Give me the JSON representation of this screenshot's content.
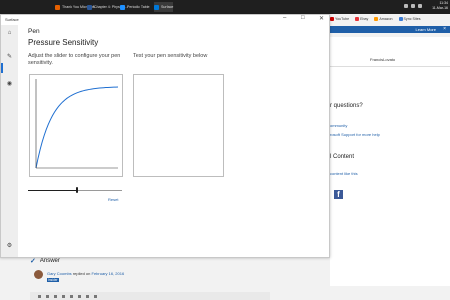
{
  "taskbar": {
    "apps": [
      {
        "label": "Thank You Microsoft...",
        "color": "#e66000",
        "active": false
      },
      {
        "label": "Chapter 4: Physical...",
        "color": "#2b5797",
        "active": false
      },
      {
        "label": "Periodic Table",
        "color": "#1e90ff",
        "active": false
      },
      {
        "label": "Surface",
        "color": "#0078d7",
        "active": true
      }
    ],
    "time": "11:34",
    "date": "11-Mar-16"
  },
  "browser": {
    "bookmarks": [
      {
        "label": "YouTube",
        "color": "#cc0000"
      },
      {
        "label": "Ebay",
        "color": "#e53238"
      },
      {
        "label": "Amazon",
        "color": "#ff9900"
      },
      {
        "label": "Sync Sites",
        "color": "#3a7bd5"
      }
    ],
    "learn_more": "Learn More",
    "close": "×",
    "user_name": "FrancisLovato",
    "questions_heading": "r questions?",
    "community_link": "ommunity",
    "support_link": "rosoft Support for more help",
    "content_heading": "l Content",
    "content_link": "content like this",
    "facebook_glyph": "f"
  },
  "answer": {
    "heading": "Answer",
    "author": "Gary Coombs",
    "replied_text": "replied on",
    "date": "February 16, 2016",
    "badge": "Insider"
  },
  "app": {
    "window_title": "Surface",
    "controls": {
      "minimize": "–",
      "maximize": "□",
      "close": "✕"
    },
    "nav_icons": [
      "home-icon",
      "pen-icon",
      "touch-icon",
      "settings-icon"
    ],
    "pen_title": "Pen",
    "section_title": "Pressure Sensitivity",
    "slider_instruction": "Adjust the slider to configure your pen sensitivity.",
    "test_instruction": "Test your pen sensitivity below",
    "reset_label": "Reset",
    "slider_value": 0.52,
    "accent_color": "#1f6fd1"
  }
}
